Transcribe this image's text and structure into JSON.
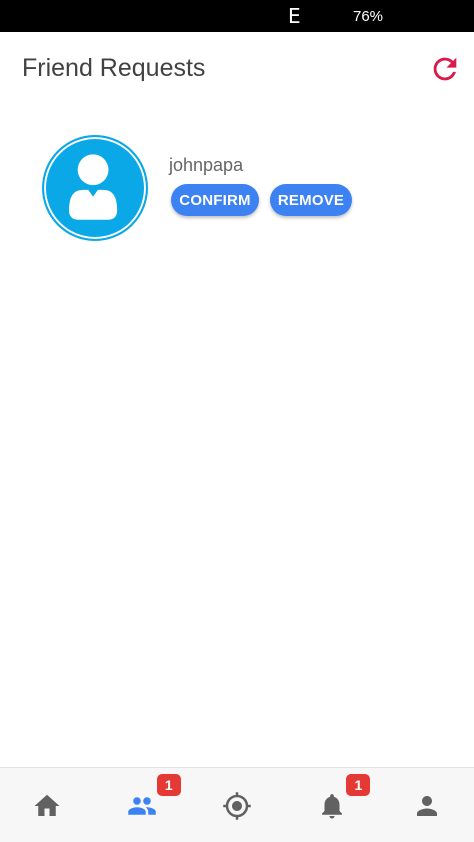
{
  "status_bar": {
    "carrier": "E",
    "battery": "76%"
  },
  "header": {
    "title": "Friend Requests",
    "refresh_icon": "refresh-icon"
  },
  "requests": [
    {
      "username": "johnpapa",
      "avatar_icon": "default-user-avatar-icon",
      "confirm_label": "CONFIRM",
      "remove_label": "REMOVE"
    }
  ],
  "bottom_nav": [
    {
      "id": "home",
      "icon": "home-icon",
      "badge": null,
      "active": false
    },
    {
      "id": "friends",
      "icon": "people-icon",
      "badge": "1",
      "active": true
    },
    {
      "id": "location",
      "icon": "gps-target-icon",
      "badge": null,
      "active": false
    },
    {
      "id": "notifications",
      "icon": "bell-icon",
      "badge": "1",
      "active": false
    },
    {
      "id": "profile",
      "icon": "person-icon",
      "badge": null,
      "active": false
    }
  ],
  "colors": {
    "accent": "#3d82f2",
    "refresh": "#d81b4a",
    "avatar": "#0aa8e6",
    "badge": "#e53935",
    "nav_inactive": "#616161",
    "nav_active": "#3d82f2"
  }
}
